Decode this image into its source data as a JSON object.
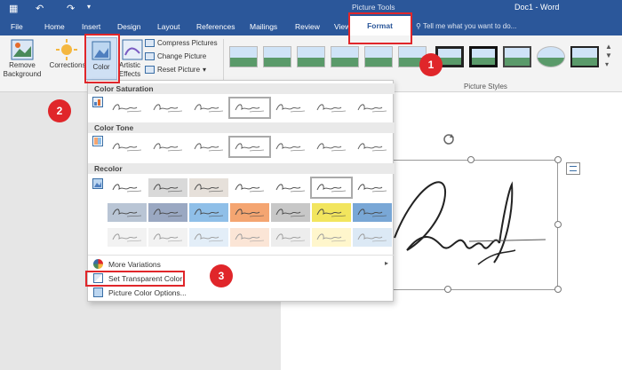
{
  "titlebar": {
    "save_icon": "save-icon",
    "undo_icon": "undo-icon",
    "redo_icon": "redo-icon",
    "context_tools": "Picture Tools",
    "document_title": "Doc1 - Word"
  },
  "tabs": [
    "File",
    "Home",
    "Insert",
    "Design",
    "Layout",
    "References",
    "Mailings",
    "Review",
    "View"
  ],
  "active_tab": "Format",
  "tell_me": "Tell me what you want to do...",
  "ribbon": {
    "remove_background": "Remove Background",
    "corrections": "Corrections",
    "color": "Color",
    "artistic_effects": "Artistic Effects",
    "compress_pictures": "Compress Pictures",
    "change_picture": "Change Picture",
    "reset_picture": "Reset Picture",
    "picture_styles": "Picture Styles"
  },
  "dropdown": {
    "color_saturation": "Color Saturation",
    "color_tone": "Color Tone",
    "recolor": "Recolor",
    "more_variations": "More Variations",
    "set_transparent_color": "Set Transparent Color",
    "picture_color_options": "Picture Color Options..."
  },
  "recolor_tints": [
    "#ffffff",
    "#d9d9d9",
    "#e6e0da",
    "#ffffff",
    "#ffffff",
    "#ffffff",
    "#ffffff",
    "#ffffff",
    "#b9c5d5",
    "#9aa8c2",
    "#8fbfe8",
    "#f4a571",
    "#c7c7c7",
    "#f2e55e",
    "#79a7d6",
    "#8fd48f",
    "#f2f2f2",
    "#f2f2f2",
    "#e3eef8",
    "#fbe5d6",
    "#ededed",
    "#fff6cc",
    "#dce9f5",
    "#e2f0d9"
  ],
  "callouts": [
    "1",
    "2",
    "3"
  ],
  "colors": {
    "word_blue": "#2b579a",
    "highlight_red": "#e0262a"
  }
}
